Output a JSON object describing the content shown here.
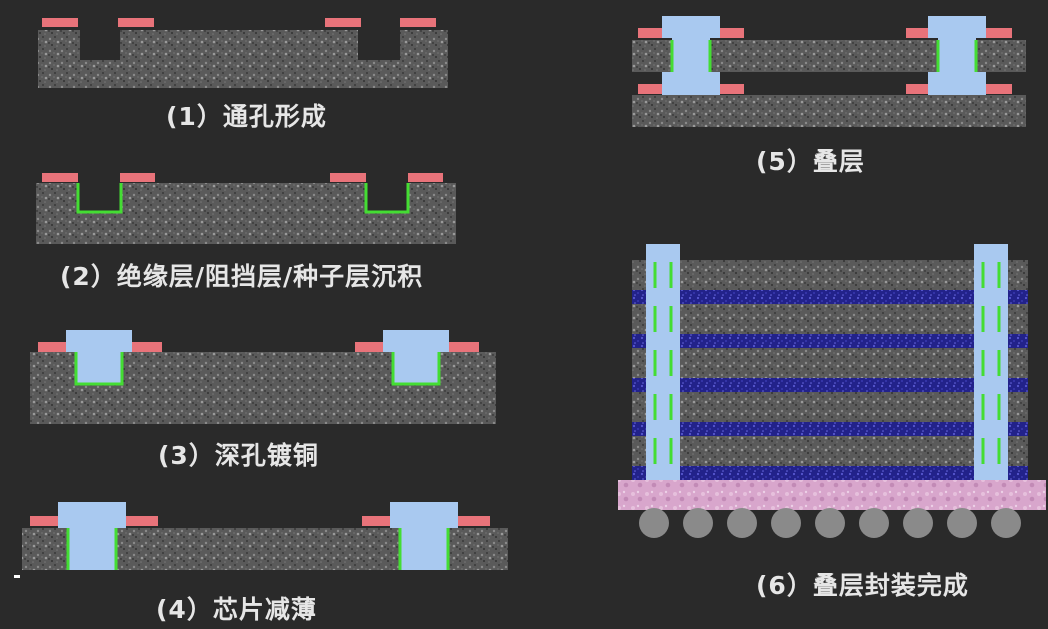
{
  "steps": [
    {
      "label": "(1）通孔形成"
    },
    {
      "label": "(2）绝缘层/阻挡层/种子层沉积"
    },
    {
      "label": "(3）深孔镀铜"
    },
    {
      "label": "(4）芯片减薄"
    },
    {
      "label": "(5）叠层"
    },
    {
      "label": "(6）叠层封装完成"
    }
  ],
  "colors": {
    "background": "#2a2a2a",
    "silicon": "#5e5e5e",
    "pad": "#e8737a",
    "liner": "#44dd33",
    "copper": "#a9c9f0",
    "underfill": "#2a2a8c",
    "substrate": "#d4a0c8",
    "bump": "#8a8a8a",
    "text": "#e6e6e6"
  },
  "legend_note": ""
}
